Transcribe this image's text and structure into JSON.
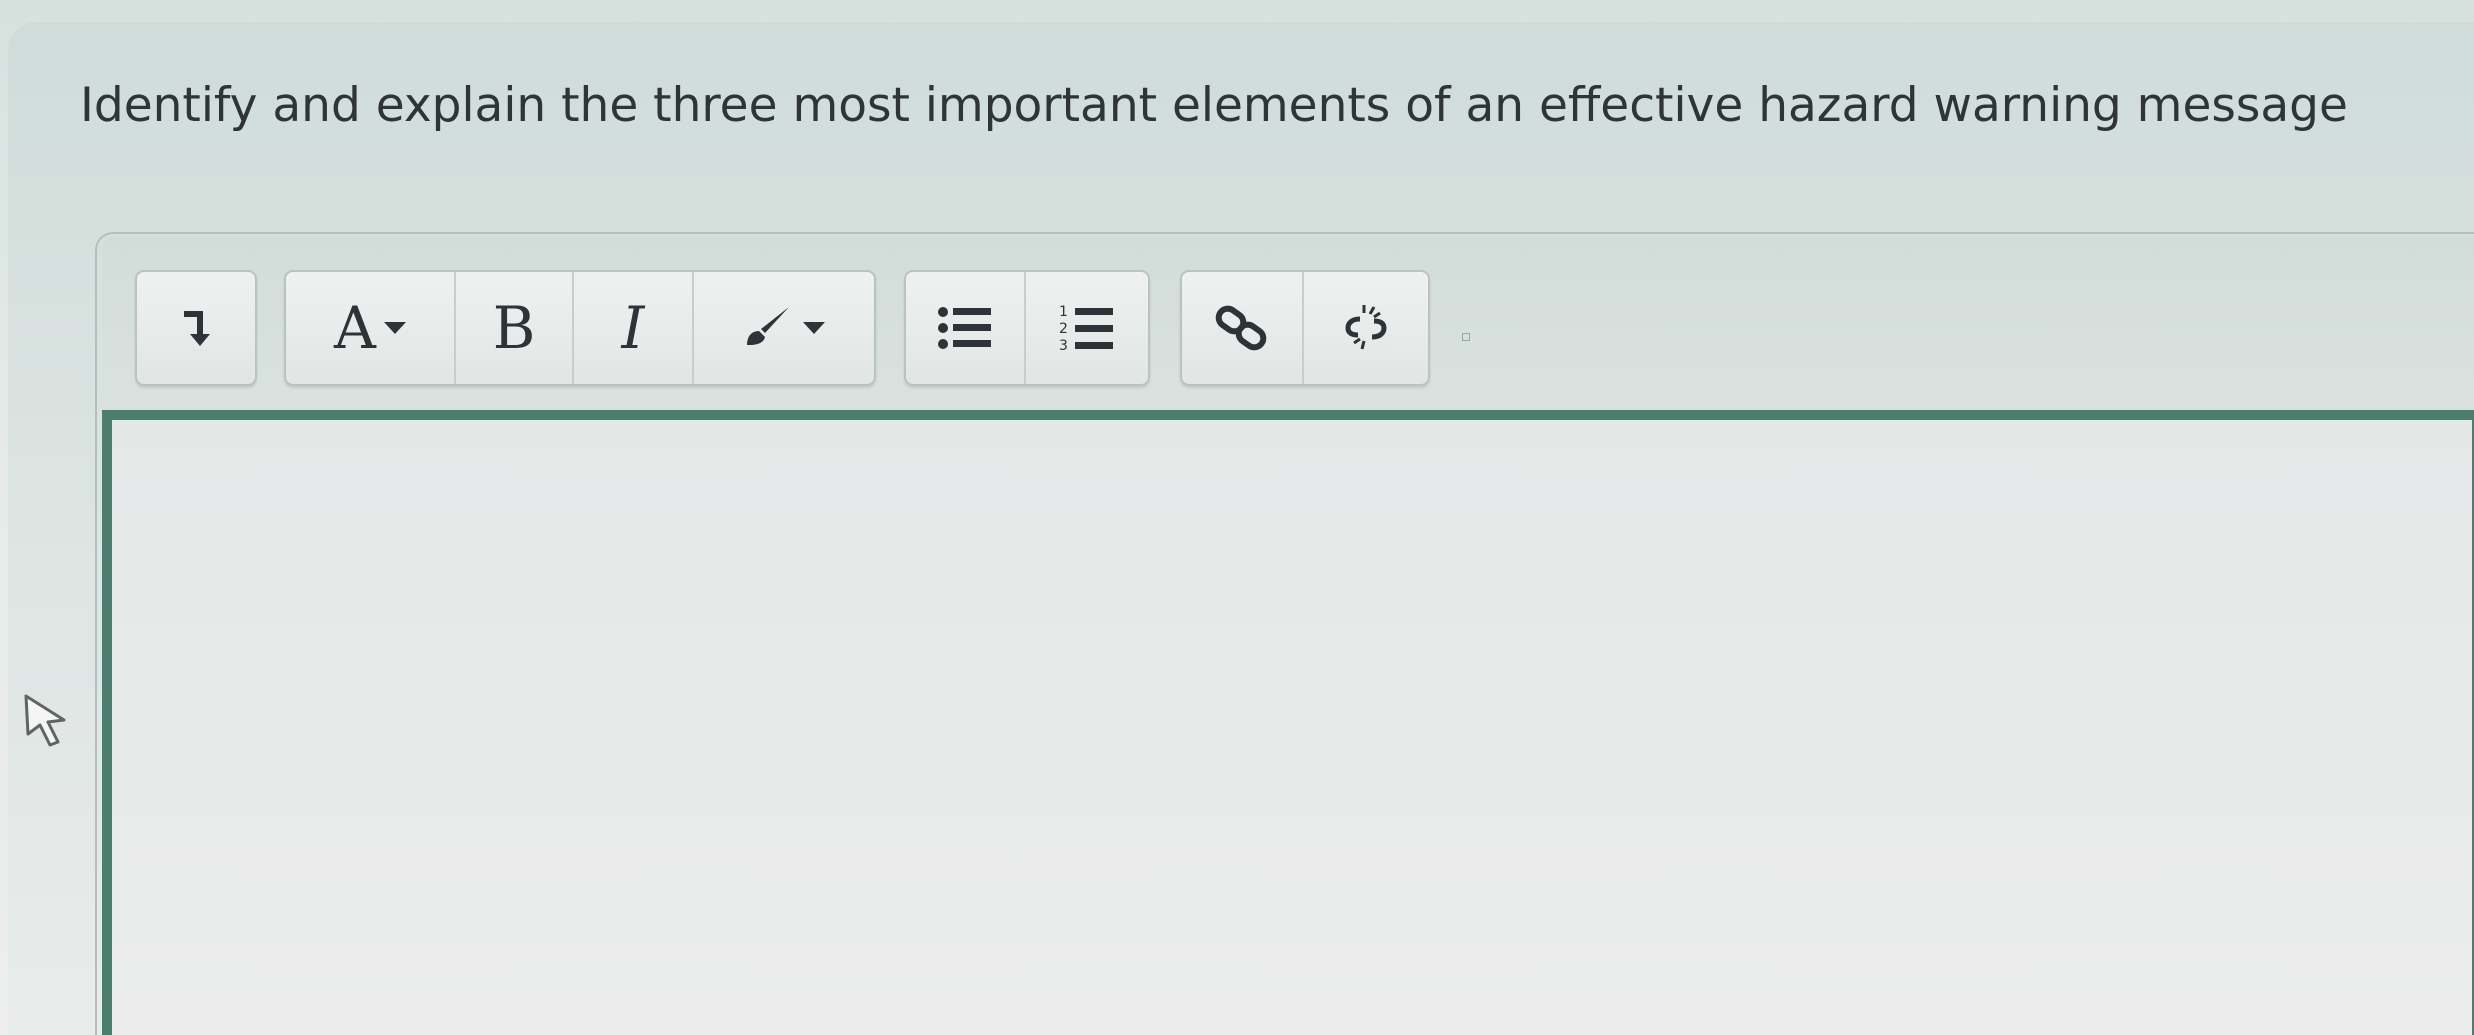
{
  "question": {
    "text": "Identify and explain the three most important elements of an effective hazard warning message"
  },
  "toolbar": {
    "paragraph_icon": "paragraph-format-icon",
    "font_label": "A",
    "bold_label": "B",
    "italic_label": "I",
    "color_icon": "paintbrush-icon",
    "bullet_list_icon": "bullet-list-icon",
    "numbered_list_icon": "numbered-list-icon",
    "link_icon": "link-icon",
    "unlink_icon": "unlink-icon"
  },
  "editor": {
    "value": ""
  },
  "colors": {
    "focus_border": "#4b7e6e",
    "text": "#2f3435"
  }
}
